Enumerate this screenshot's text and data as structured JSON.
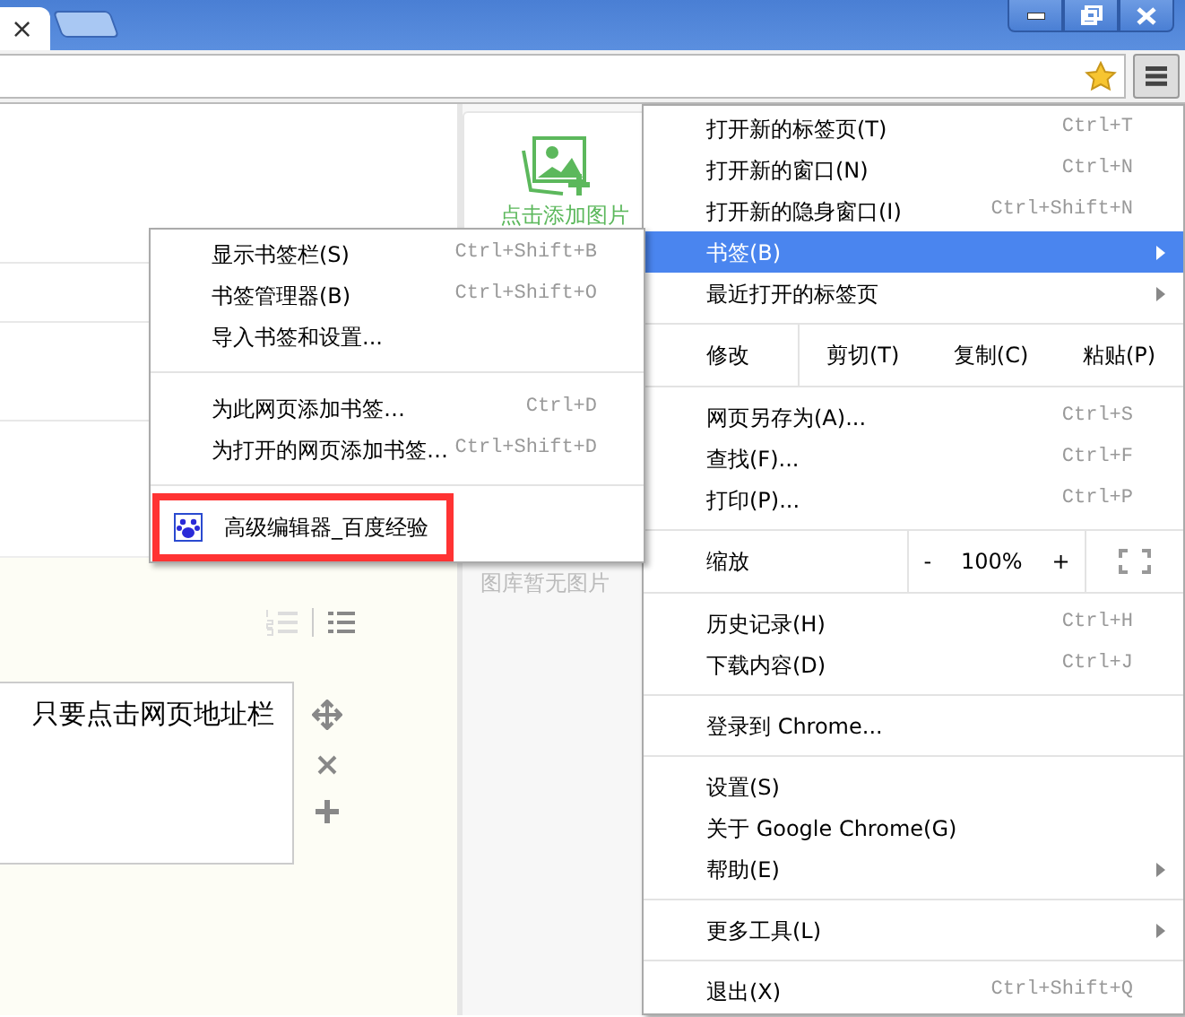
{
  "tab": {
    "close": "×"
  },
  "page": {
    "upload_label": "点击添加图片",
    "gallery_empty": "图库暂无图片",
    "editor_text": "只要点击网页地址栏"
  },
  "menu": {
    "items": [
      {
        "kind": "item",
        "label": "打开新的标签页(T)",
        "shortcut": "Ctrl+T",
        "submenu": false,
        "selected": false
      },
      {
        "kind": "item",
        "label": "打开新的窗口(N)",
        "shortcut": "Ctrl+N",
        "submenu": false,
        "selected": false
      },
      {
        "kind": "item",
        "label": "打开新的隐身窗口(I)",
        "shortcut": "Ctrl+Shift+N",
        "submenu": false,
        "selected": false
      },
      {
        "kind": "item",
        "label": "书签(B)",
        "submenu": true,
        "selected": true
      },
      {
        "kind": "item",
        "label": "最近打开的标签页",
        "submenu": true,
        "selected": false
      },
      {
        "kind": "separator"
      },
      {
        "kind": "edit_row",
        "label": "修改",
        "buttons": [
          "剪切(T)",
          "复制(C)",
          "粘贴(P)"
        ]
      },
      {
        "kind": "separator"
      },
      {
        "kind": "item",
        "label": "网页另存为(A)...",
        "shortcut": "Ctrl+S",
        "submenu": false,
        "selected": false
      },
      {
        "kind": "item",
        "label": "查找(F)...",
        "shortcut": "Ctrl+F",
        "submenu": false,
        "selected": false
      },
      {
        "kind": "item",
        "label": "打印(P)...",
        "shortcut": "Ctrl+P",
        "submenu": false,
        "selected": false
      },
      {
        "kind": "separator"
      },
      {
        "kind": "zoom_row",
        "label": "缩放",
        "minus": "-",
        "value": "100%",
        "plus": "+"
      },
      {
        "kind": "separator"
      },
      {
        "kind": "item",
        "label": "历史记录(H)",
        "shortcut": "Ctrl+H",
        "submenu": false,
        "selected": false
      },
      {
        "kind": "item",
        "label": "下载内容(D)",
        "shortcut": "Ctrl+J",
        "submenu": false,
        "selected": false
      },
      {
        "kind": "separator"
      },
      {
        "kind": "item",
        "label": "登录到 Chrome...",
        "submenu": false,
        "selected": false
      },
      {
        "kind": "separator"
      },
      {
        "kind": "item",
        "label": "设置(S)",
        "submenu": false,
        "selected": false
      },
      {
        "kind": "item",
        "label": "关于 Google Chrome(G)",
        "submenu": false,
        "selected": false
      },
      {
        "kind": "item",
        "label": "帮助(E)",
        "submenu": true,
        "selected": false
      },
      {
        "kind": "separator"
      },
      {
        "kind": "item",
        "label": "更多工具(L)",
        "submenu": true,
        "selected": false
      },
      {
        "kind": "separator"
      },
      {
        "kind": "item",
        "label": "退出(X)",
        "shortcut": "Ctrl+Shift+Q",
        "submenu": false,
        "selected": false
      }
    ]
  },
  "bookmarks_menu": {
    "items": [
      {
        "kind": "item",
        "label": "显示书签栏(S)",
        "shortcut": "Ctrl+Shift+B"
      },
      {
        "kind": "item",
        "label": "书签管理器(B)",
        "shortcut": "Ctrl+Shift+O"
      },
      {
        "kind": "item",
        "label": "导入书签和设置..."
      },
      {
        "kind": "separator"
      },
      {
        "kind": "item",
        "label": "为此网页添加书签…",
        "shortcut": "Ctrl+D"
      },
      {
        "kind": "item",
        "label": "为打开的网页添加书签…",
        "shortcut": "Ctrl+Shift+D"
      },
      {
        "kind": "separator"
      },
      {
        "kind": "bookmark",
        "label": "高级编辑器_百度经验",
        "highlighted": true
      }
    ]
  }
}
